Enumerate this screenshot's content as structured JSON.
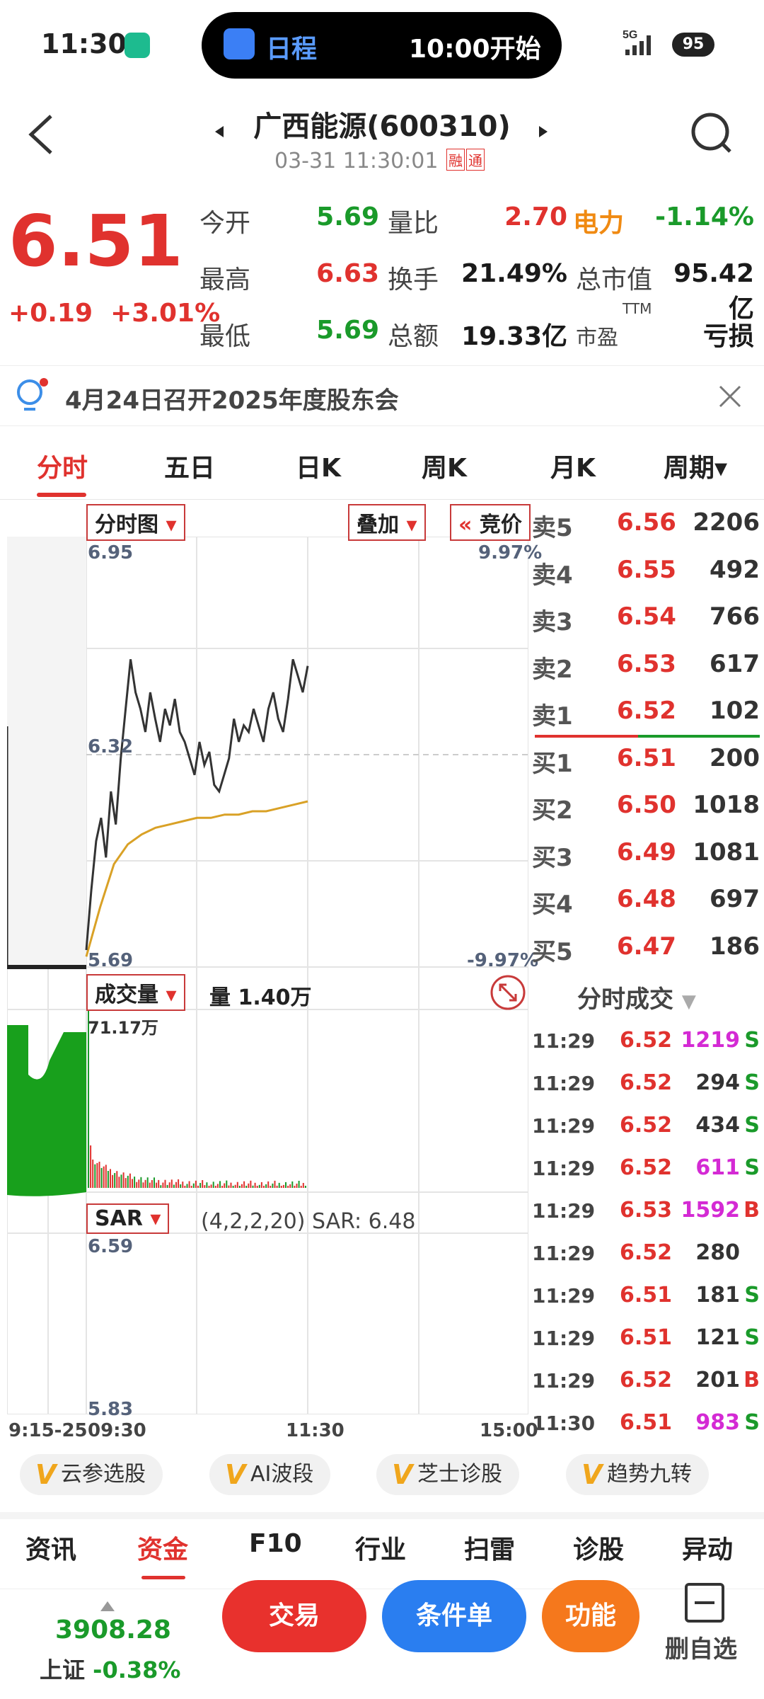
{
  "status": {
    "time": "11:30",
    "island_label": "日程",
    "island_time": "10:00开始",
    "network": "5G",
    "battery": "95"
  },
  "header": {
    "title": "广西能源(600310)",
    "datetime": "03-31 11:30:01",
    "tag_margin": "融",
    "tag_connect": "通"
  },
  "quote": {
    "price": "6.51",
    "change": "+0.19",
    "change_pct": "+3.01%",
    "open_label": "今开",
    "open": "5.69",
    "high_label": "最高",
    "high": "6.63",
    "low_label": "最低",
    "low": "5.69",
    "vol_ratio_label": "量比",
    "vol_ratio": "2.70",
    "turnover_label": "换手",
    "turnover": "21.49%",
    "amount_label": "总额",
    "amount": "19.33亿",
    "sector": "电力",
    "sector_pct": "-1.14%",
    "mktcap_label": "总市值",
    "mktcap": "95.42亿",
    "pe_label": "市盈",
    "pe_ttm": "TTM",
    "pe": "亏损"
  },
  "notice": {
    "text": "4月24日召开2025年度股东会"
  },
  "tabs": [
    "分时",
    "五日",
    "日K",
    "周K",
    "月K",
    "周期▾"
  ],
  "chart": {
    "mode": "分时图",
    "overlay": "叠加",
    "auction": "竞价",
    "price_top": "6.95",
    "price_mid": "6.32",
    "price_bottom": "5.69",
    "pct_top": "9.97%",
    "pct_bottom": "-9.97%",
    "vol_label": "成交量",
    "vol_value": "量 1.40万",
    "vol_max": "71.17万",
    "sar_label": "SAR",
    "sar_params": "(4,2,2,20) SAR: 6.48",
    "sar_top": "6.59",
    "sar_bottom": "5.83",
    "x_labels": [
      "9:15-25",
      "09:30",
      "11:30",
      "15:00"
    ],
    "price_series": [
      5.72,
      5.9,
      6.05,
      6.12,
      6.0,
      6.2,
      6.1,
      6.3,
      6.45,
      6.6,
      6.5,
      6.45,
      6.38,
      6.5,
      6.42,
      6.35,
      6.45,
      6.4,
      6.48,
      6.38,
      6.35,
      6.3,
      6.25,
      6.35,
      6.28,
      6.32,
      6.22,
      6.2,
      6.25,
      6.3,
      6.42,
      6.35,
      6.4,
      6.38,
      6.45,
      6.4,
      6.35,
      6.45,
      6.5,
      6.42,
      6.38,
      6.48,
      6.6,
      6.55,
      6.5,
      6.58
    ],
    "avg_series": [
      5.7,
      5.85,
      5.98,
      6.04,
      6.07,
      6.09,
      6.1,
      6.11,
      6.12,
      6.12,
      6.13,
      6.13,
      6.14,
      6.14,
      6.15,
      6.16,
      6.17
    ]
  },
  "order_book": {
    "asks": [
      {
        "label": "卖5",
        "price": "6.56",
        "vol": "2206"
      },
      {
        "label": "卖4",
        "price": "6.55",
        "vol": "492"
      },
      {
        "label": "卖3",
        "price": "6.54",
        "vol": "766"
      },
      {
        "label": "卖2",
        "price": "6.53",
        "vol": "617"
      },
      {
        "label": "卖1",
        "price": "6.52",
        "vol": "102"
      }
    ],
    "bids": [
      {
        "label": "买1",
        "price": "6.51",
        "vol": "200"
      },
      {
        "label": "买2",
        "price": "6.50",
        "vol": "1018"
      },
      {
        "label": "买3",
        "price": "6.49",
        "vol": "1081"
      },
      {
        "label": "买4",
        "price": "6.48",
        "vol": "697"
      },
      {
        "label": "买5",
        "price": "6.47",
        "vol": "186"
      }
    ]
  },
  "trades_title": "分时成交",
  "trades": [
    {
      "time": "11:29",
      "price": "6.52",
      "vol": "1219",
      "side": "S",
      "big": true
    },
    {
      "time": "11:29",
      "price": "6.52",
      "vol": "294",
      "side": "S",
      "big": false
    },
    {
      "time": "11:29",
      "price": "6.52",
      "vol": "434",
      "side": "S",
      "big": false
    },
    {
      "time": "11:29",
      "price": "6.52",
      "vol": "611",
      "side": "S",
      "big": true
    },
    {
      "time": "11:29",
      "price": "6.53",
      "vol": "1592",
      "side": "B",
      "big": true
    },
    {
      "time": "11:29",
      "price": "6.52",
      "vol": "280",
      "side": "",
      "big": false
    },
    {
      "time": "11:29",
      "price": "6.51",
      "vol": "181",
      "side": "S",
      "big": false
    },
    {
      "time": "11:29",
      "price": "6.51",
      "vol": "121",
      "side": "S",
      "big": false
    },
    {
      "time": "11:29",
      "price": "6.52",
      "vol": "201",
      "side": "B",
      "big": false
    },
    {
      "time": "11:30",
      "price": "6.51",
      "vol": "983",
      "side": "S",
      "big": true
    }
  ],
  "ai_chips": [
    "云参选股",
    "AI波段",
    "芝士诊股",
    "趋势九转"
  ],
  "bottom_tabs": [
    "资讯",
    "资金",
    "F10",
    "行业",
    "扫雷",
    "诊股",
    "异动"
  ],
  "index": {
    "value": "3908.28",
    "name": "上证",
    "pct": "-0.38%"
  },
  "actions": {
    "trade": "交易",
    "condition": "条件单",
    "function": "功能",
    "remove": "删自选"
  },
  "colors": {
    "up": "#e0322e",
    "down": "#1a9a2a",
    "avg_line": "#d9a126",
    "big_trade": "#d42ad4"
  }
}
